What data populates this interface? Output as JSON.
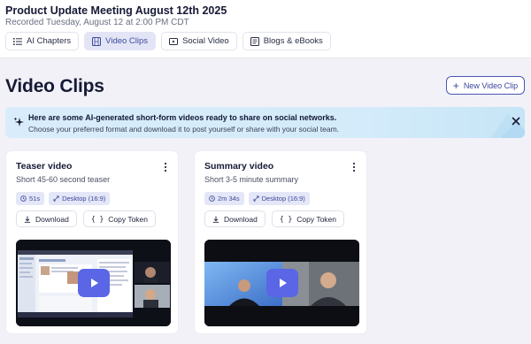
{
  "header": {
    "title": "Product Update Meeting August 12th 2025",
    "subtitle": "Recorded Tuesday, August 12 at 2:00 PM CDT",
    "tabs": [
      {
        "label": "AI Chapters",
        "icon": "list-icon",
        "active": false
      },
      {
        "label": "Video Clips",
        "icon": "film-icon",
        "active": true
      },
      {
        "label": "Social Video",
        "icon": "play-box-icon",
        "active": false
      },
      {
        "label": "Blogs & eBooks",
        "icon": "book-icon",
        "active": false
      }
    ]
  },
  "page": {
    "heading": "Video Clips",
    "new_button": "New Video Clip"
  },
  "banner": {
    "line1": "Here are some AI-generated short-form videos ready to share on social networks.",
    "line2": "Choose your preferred format and download it to post yourself or share with your social team."
  },
  "cards": [
    {
      "title": "Teaser video",
      "subtitle": "Short 45-60 second teaser",
      "duration": "51s",
      "format": "Desktop (16:9)",
      "download": "Download",
      "copy_token": "Copy Token"
    },
    {
      "title": "Summary video",
      "subtitle": "Short 3-5 minute summary",
      "duration": "2m 34s",
      "format": "Desktop (16:9)",
      "download": "Download",
      "copy_token": "Copy Token"
    }
  ],
  "colors": {
    "accent": "#4b57b5",
    "play_button": "#5a66e6",
    "banner_bg": "#d7ecfb",
    "page_bg": "#f1f1f7"
  }
}
